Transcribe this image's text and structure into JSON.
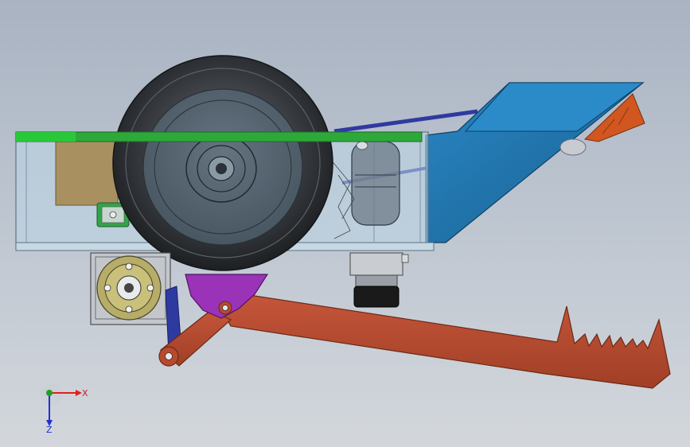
{
  "triad": {
    "x_label": "X",
    "z_label": "Z"
  },
  "colors": {
    "background_top": "#a9b3c2",
    "background_bottom": "#d3d7dc",
    "frame_top_rail": "#2fa83a",
    "chassis_glass": "#bcd6e6",
    "scoop_blue": "#1f6fa6",
    "scoop_orange": "#d2561f",
    "arm_red": "#b84a2e",
    "bracket_purple": "#9a33b8",
    "strut_blue": "#2f3aa0",
    "box_tan": "#a68a52",
    "tire_dark": "#2f3236",
    "motor_olive": "#b6ad6a",
    "actuator_black": "#1a1a1a",
    "x_axis": "#e02020",
    "y_axis": "#20a020",
    "z_axis": "#2030d0"
  },
  "icons": [
    "coordinate-triad-icon"
  ]
}
